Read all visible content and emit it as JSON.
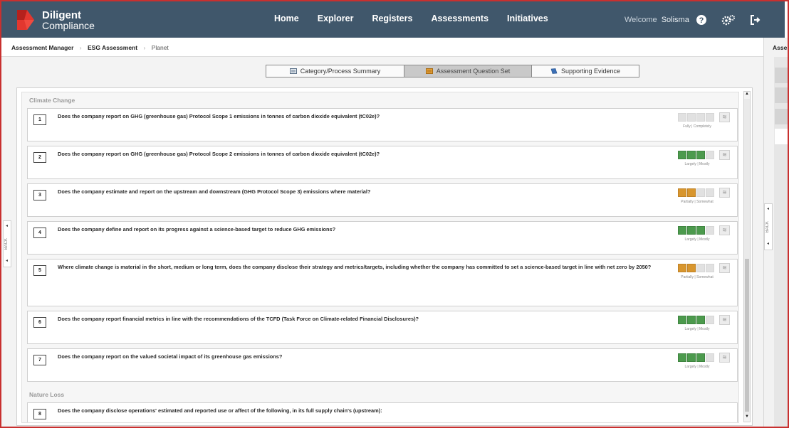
{
  "brand": {
    "name_line1": "Diligent",
    "name_line2": "Compliance"
  },
  "nav": {
    "items": [
      "Home",
      "Explorer",
      "Registers",
      "Assessments",
      "Initiatives"
    ]
  },
  "user": {
    "welcome": "Welcome",
    "name": "Solisma"
  },
  "breadcrumb": {
    "items": [
      "Assessment Manager",
      "ESG Assessment"
    ],
    "current": "Planet"
  },
  "right_panel": {
    "heading": "Asse"
  },
  "side_buttons": {
    "label": "BACK"
  },
  "tabs": [
    "Category/Process Summary",
    "Assessment Question Set",
    "Supporting Evidence"
  ],
  "sections": [
    {
      "title": "Climate Change"
    },
    {
      "title": "Nature Loss"
    }
  ],
  "questions": [
    {
      "num": "1",
      "text": "Does the company report on GHG (greenhouse gas) Protocol Scope 1 emissions in tonnes of carbon dioxide equivalent (tC02e)?",
      "rating_label": "Fully | Completely",
      "filled": 0,
      "color": "none"
    },
    {
      "num": "2",
      "text": "Does the company report on GHG (greenhouse gas) Protocol Scope 2 emissions in tonnes of carbon dioxide equivalent (tC02e)?",
      "rating_label": "Largely | Mostly",
      "filled": 3,
      "color": "green"
    },
    {
      "num": "3",
      "text": "Does the company estimate and report on the upstream and downstream (GHG Protocol Scope 3) emissions where material?",
      "rating_label": "Partially | Somewhat",
      "filled": 2,
      "color": "orange"
    },
    {
      "num": "4",
      "text": "Does the company define and report on its progress against a science-based target to reduce GHG emissions?",
      "rating_label": "Largely | Mostly",
      "filled": 3,
      "color": "green"
    },
    {
      "num": "5",
      "text": "Where climate change is material in the short, medium or long term, does the company disclose their strategy and metrics/targets, including whether the company has committed to set a science-based target in line with net zero by 2050?",
      "rating_label": "Partially | Somewhat",
      "filled": 2,
      "color": "orange"
    },
    {
      "num": "6",
      "text": "Does the company report financial metrics in line with the recommendations of the TCFD (Task Force on Climate-related Financial Disclosures)?",
      "rating_label": "Largely | Mostly",
      "filled": 3,
      "color": "green"
    },
    {
      "num": "7",
      "text": "Does the company report on the valued societal impact of its greenhouse gas emissions?",
      "rating_label": "Largely | Mostly",
      "filled": 3,
      "color": "green"
    },
    {
      "num": "8",
      "text": "Does the company disclose operations' estimated and reported use or affect of the following, in its full supply chain's (upstream):",
      "rating_label": "",
      "filled": 0,
      "color": "none"
    }
  ],
  "colors": {
    "header": "#40576b",
    "frame": "#c8302f",
    "green": "#4c9a4d",
    "orange": "#d8962e"
  },
  "icons": [
    "diligent-logo-icon",
    "help-icon",
    "settings-icon",
    "logout-icon",
    "summary-icon",
    "question-set-icon",
    "evidence-icon",
    "stack-icon"
  ]
}
